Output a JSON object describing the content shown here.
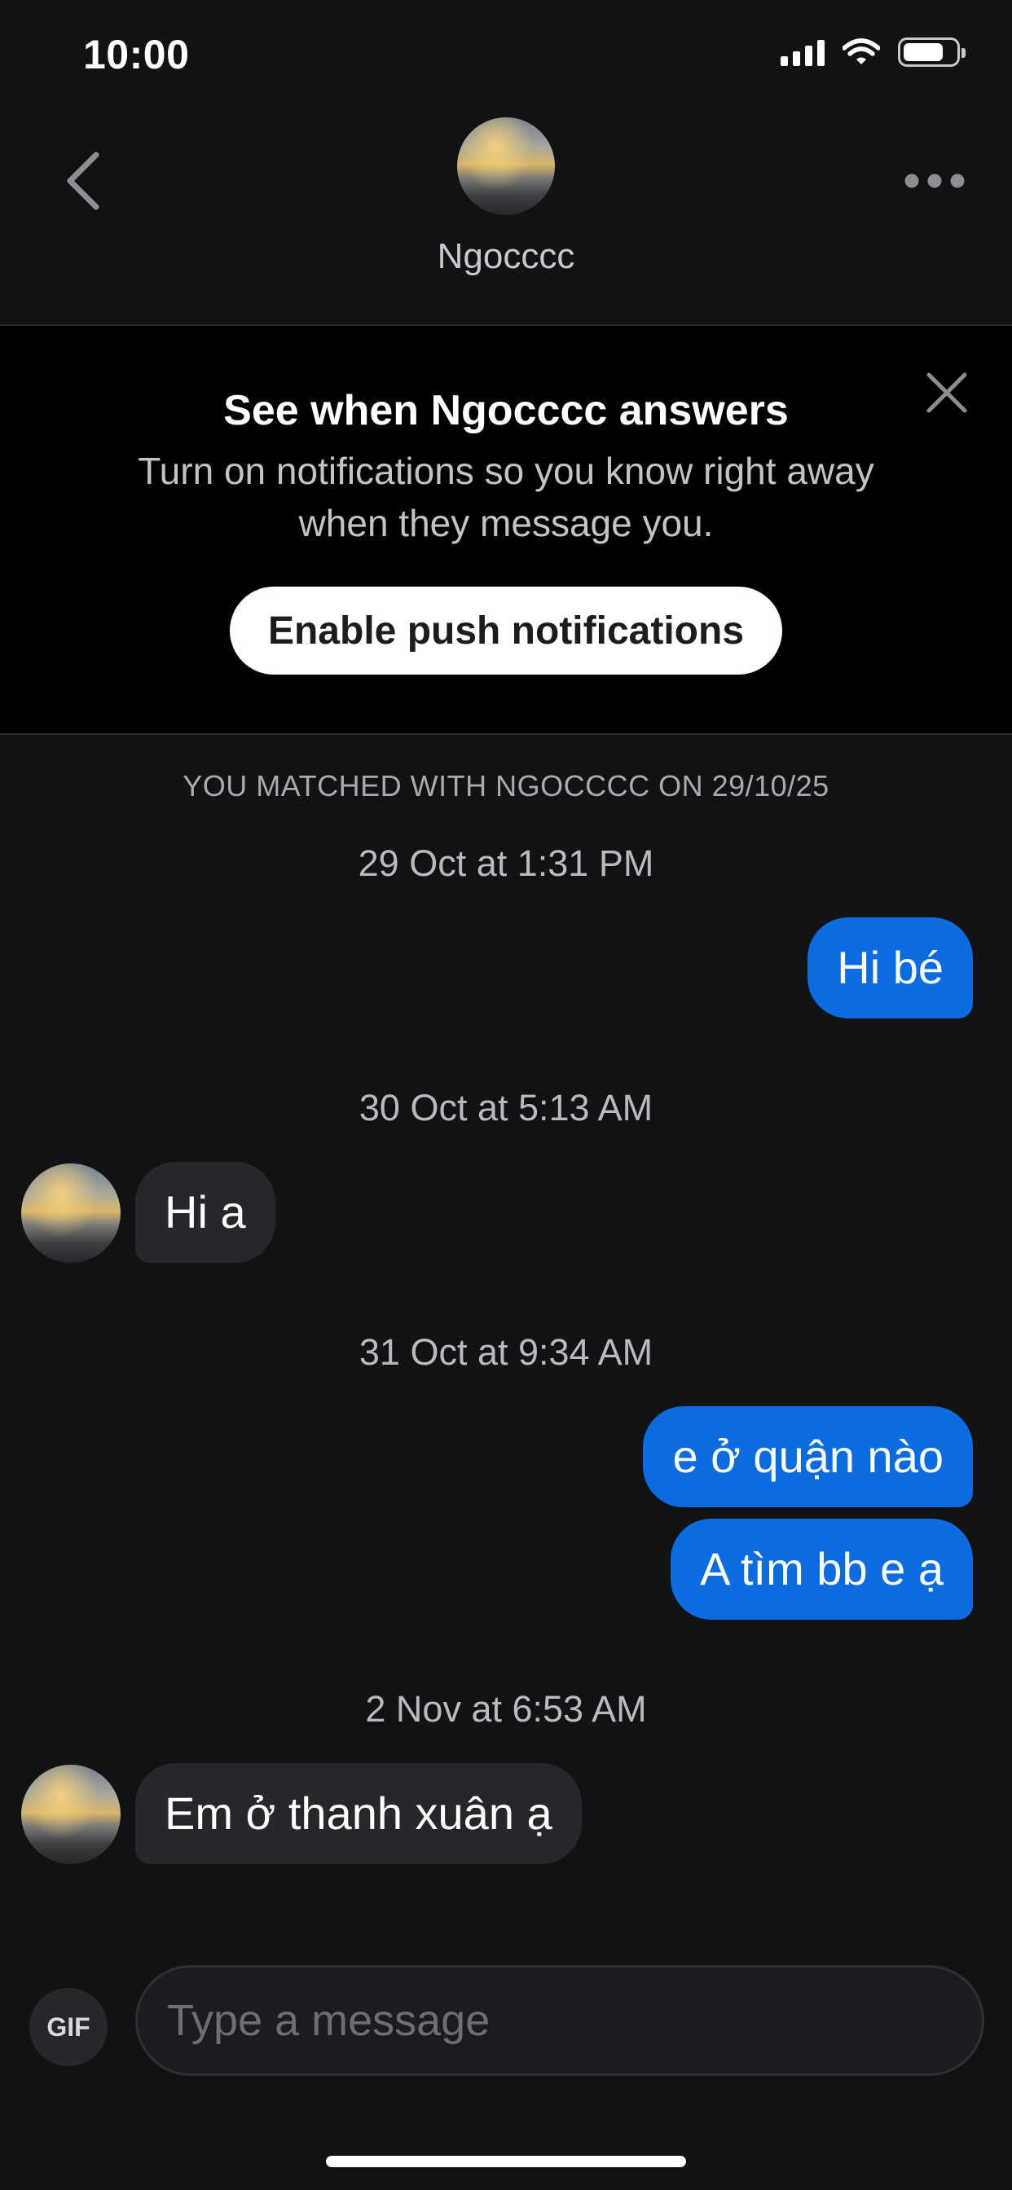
{
  "status_bar": {
    "time": "10:00"
  },
  "header": {
    "contact_name": "Ngocccc"
  },
  "notification": {
    "title": "See when Ngocccc answers",
    "body": "Turn on notifications so you know right away when they message you.",
    "button_label": "Enable push notifications"
  },
  "chat": {
    "match_label": "YOU MATCHED WITH NGOCCCC ON 29/10/25",
    "timestamps": [
      "29 Oct at 1:31 PM",
      "30 Oct at 5:13 AM",
      "31 Oct at 9:34 AM",
      "2 Nov at 6:53 AM"
    ],
    "messages": [
      {
        "direction": "outgoing",
        "text": "Hi bé"
      },
      {
        "direction": "incoming",
        "text": "Hi a"
      },
      {
        "direction": "outgoing",
        "text": "e ở quận nào"
      },
      {
        "direction": "outgoing",
        "text": "A tìm bb e ạ"
      },
      {
        "direction": "incoming",
        "text": "Em ở thanh xuân ạ"
      }
    ]
  },
  "composer": {
    "gif_label": "GIF",
    "placeholder": "Type a message"
  },
  "colors": {
    "background": "#111214",
    "outgoing_bubble": "#0a6ce0",
    "incoming_bubble": "#26272a",
    "banner": "#000000"
  },
  "icons": {
    "back": "chevron-left-icon",
    "more": "more-horizontal-icon",
    "close": "close-icon",
    "signal": "cellular-signal-icon",
    "wifi": "wifi-icon",
    "battery": "battery-icon"
  }
}
